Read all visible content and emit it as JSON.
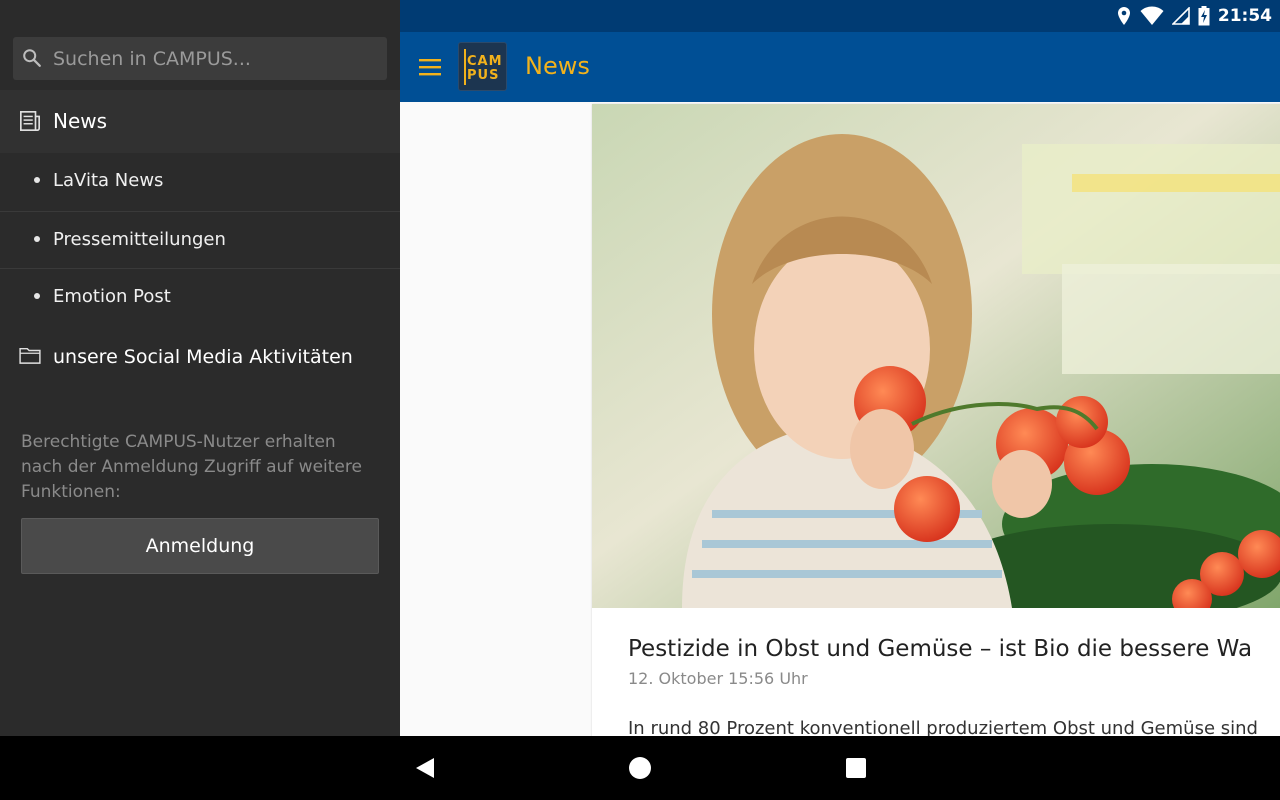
{
  "drawer": {
    "search": {
      "placeholder": "Suchen in CAMPUS..."
    },
    "news_label": "News",
    "sub_items": [
      "LaVita News",
      "Pressemitteilungen",
      "Emotion Post"
    ],
    "social_label": "unsere Social Media Aktivitäten",
    "login_hint": "Berechtigte CAMPUS-Nutzer erhalten nach der Anmeldung Zugriff auf weitere Funktionen:",
    "login_button": "Anmeldung"
  },
  "status_bar": {
    "time": "21:54"
  },
  "app_bar": {
    "logo_line1": "CAM",
    "logo_line2": "PUS",
    "title": "News"
  },
  "article": {
    "title": "Pestizide in Obst und Gemüse – ist Bio die bessere Wa",
    "date": "12. Oktober 15:56 Uhr",
    "teaser": "In rund 80 Prozent konventionell produziertem Obst und Gemüse sind"
  },
  "colors": {
    "accent": "#f2b21c",
    "app_bar": "#004f95",
    "status_bar": "#003b73",
    "drawer_bg": "#2b2b2b"
  },
  "icons": {
    "search": "search-icon",
    "news": "newspaper-icon",
    "social": "folder-icon",
    "menu": "hamburger-menu-icon",
    "back": "back-icon",
    "home": "home-icon",
    "recents": "recents-icon"
  }
}
